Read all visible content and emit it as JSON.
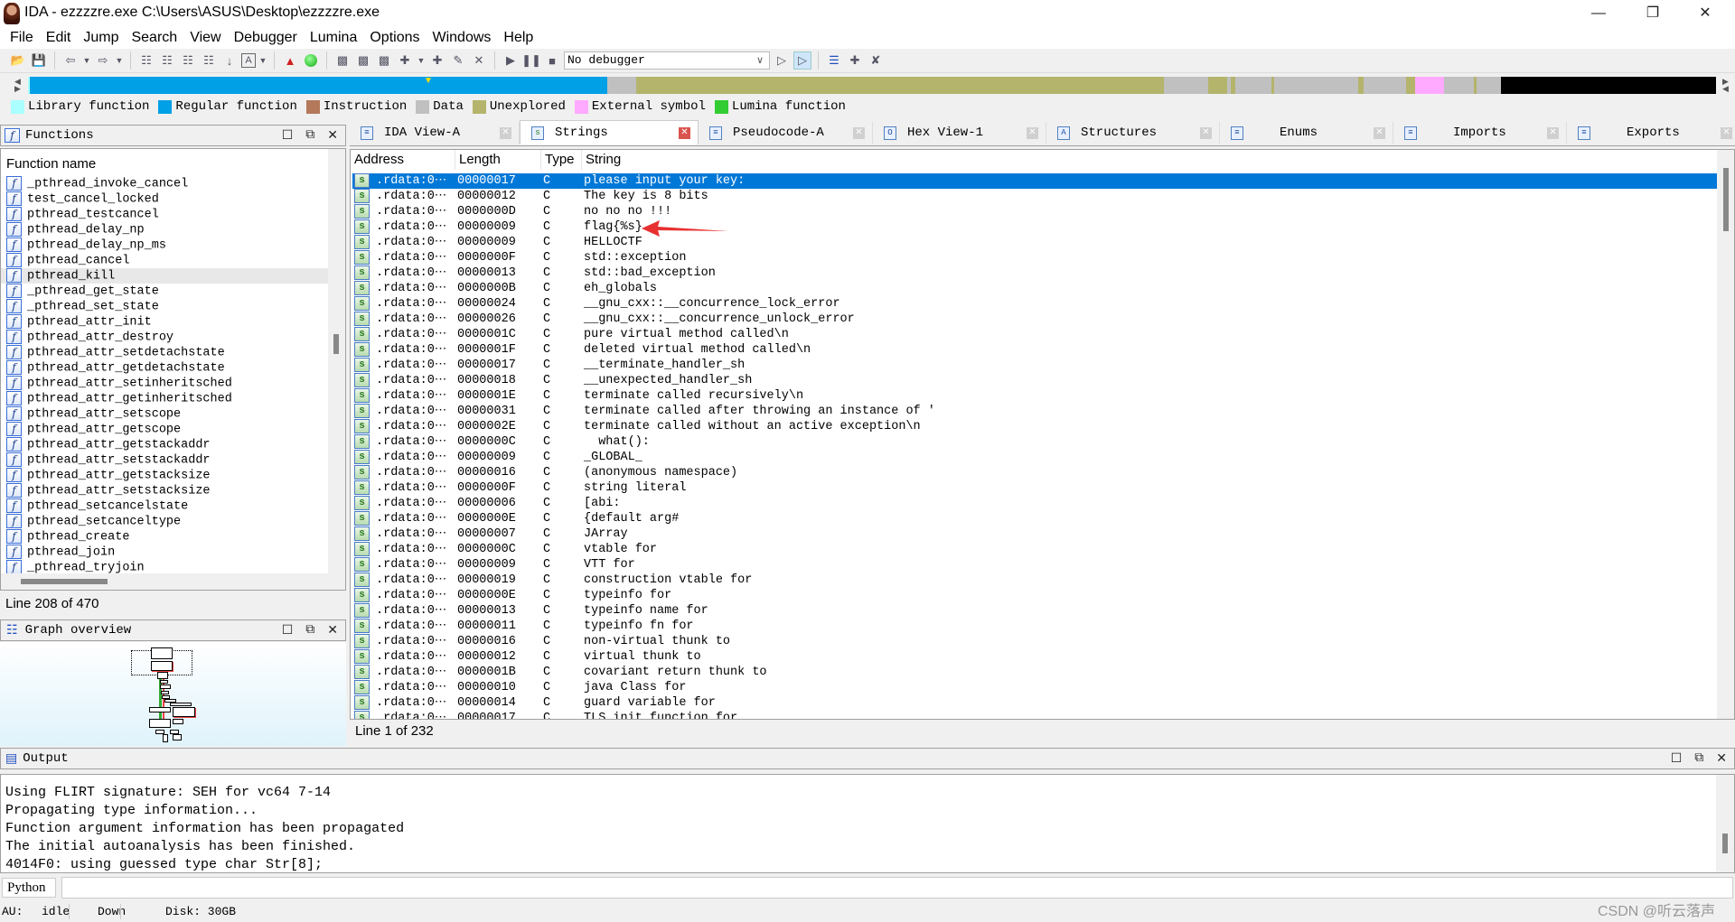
{
  "window": {
    "title": "IDA - ezzzzre.exe C:\\Users\\ASUS\\Desktop\\ezzzzre.exe",
    "controls": [
      "minimize",
      "restore",
      "close"
    ]
  },
  "menu": [
    "File",
    "Edit",
    "Jump",
    "Search",
    "View",
    "Debugger",
    "Lumina",
    "Options",
    "Windows",
    "Help"
  ],
  "toolbar": {
    "debugger_select": "No debugger"
  },
  "legend": [
    {
      "label": "Library function",
      "color": "#aaffff"
    },
    {
      "label": "Regular function",
      "color": "#00a0e6"
    },
    {
      "label": "Instruction",
      "color": "#b4785a"
    },
    {
      "label": "Data",
      "color": "#c0c0c0"
    },
    {
      "label": "Unexplored",
      "color": "#b4b46c"
    },
    {
      "label": "External symbol",
      "color": "#ffaaff"
    },
    {
      "label": "Lumina function",
      "color": "#33cc33"
    }
  ],
  "functions_panel": {
    "title": "Functions",
    "column": "Function name",
    "items": [
      "_pthread_invoke_cancel",
      "test_cancel_locked",
      "pthread_testcancel",
      "pthread_delay_np",
      "pthread_delay_np_ms",
      "pthread_cancel",
      "pthread_kill",
      "_pthread_get_state",
      "_pthread_set_state",
      "pthread_attr_init",
      "pthread_attr_destroy",
      "pthread_attr_setdetachstate",
      "pthread_attr_getdetachstate",
      "pthread_attr_setinheritsched",
      "pthread_attr_getinheritsched",
      "pthread_attr_setscope",
      "pthread_attr_getscope",
      "pthread_attr_getstackaddr",
      "pthread_attr_setstackaddr",
      "pthread_attr_getstacksize",
      "pthread_attr_setstacksize",
      "pthread_setcancelstate",
      "pthread_setcanceltype",
      "pthread_create",
      "pthread_join",
      "_pthread_tryjoin"
    ],
    "highlighted": "pthread_kill",
    "status": "Line 208 of 470"
  },
  "graph_overview": {
    "title": "Graph overview"
  },
  "tabs": [
    {
      "label": "IDA View-A",
      "icon": "disassembly-icon"
    },
    {
      "label": "Strings",
      "icon": "strings-icon",
      "active": true
    },
    {
      "label": "Pseudocode-A",
      "icon": "pseudocode-icon"
    },
    {
      "label": "Hex View-1",
      "icon": "hex-icon"
    },
    {
      "label": "Structures",
      "icon": "structures-icon"
    },
    {
      "label": "Enums",
      "icon": "enums-icon"
    },
    {
      "label": "Imports",
      "icon": "imports-icon"
    },
    {
      "label": "Exports",
      "icon": "exports-icon"
    }
  ],
  "strings": {
    "columns": [
      "Address",
      "Length",
      "Type",
      "String"
    ],
    "rows": [
      [
        ".rdata:0⋯",
        "00000017",
        "C",
        "please input your key:"
      ],
      [
        ".rdata:0⋯",
        "00000012",
        "C",
        "The key is 8 bits"
      ],
      [
        ".rdata:0⋯",
        "0000000D",
        "C",
        "no no no !!!"
      ],
      [
        ".rdata:0⋯",
        "00000009",
        "C",
        "flag{%s}"
      ],
      [
        ".rdata:0⋯",
        "00000009",
        "C",
        "HELLOCTF"
      ],
      [
        ".rdata:0⋯",
        "0000000F",
        "C",
        "std::exception"
      ],
      [
        ".rdata:0⋯",
        "00000013",
        "C",
        "std::bad_exception"
      ],
      [
        ".rdata:0⋯",
        "0000000B",
        "C",
        "eh_globals"
      ],
      [
        ".rdata:0⋯",
        "00000024",
        "C",
        "__gnu_cxx::__concurrence_lock_error"
      ],
      [
        ".rdata:0⋯",
        "00000026",
        "C",
        "__gnu_cxx::__concurrence_unlock_error"
      ],
      [
        ".rdata:0⋯",
        "0000001C",
        "C",
        "pure virtual method called\\n"
      ],
      [
        ".rdata:0⋯",
        "0000001F",
        "C",
        "deleted virtual method called\\n"
      ],
      [
        ".rdata:0⋯",
        "00000017",
        "C",
        "__terminate_handler_sh"
      ],
      [
        ".rdata:0⋯",
        "00000018",
        "C",
        "__unexpected_handler_sh"
      ],
      [
        ".rdata:0⋯",
        "0000001E",
        "C",
        "terminate called recursively\\n"
      ],
      [
        ".rdata:0⋯",
        "00000031",
        "C",
        "terminate called after throwing an instance of '"
      ],
      [
        ".rdata:0⋯",
        "0000002E",
        "C",
        "terminate called without an active exception\\n"
      ],
      [
        ".rdata:0⋯",
        "0000000C",
        "C",
        "  what():"
      ],
      [
        ".rdata:0⋯",
        "00000009",
        "C",
        "_GLOBAL_"
      ],
      [
        ".rdata:0⋯",
        "00000016",
        "C",
        "(anonymous namespace)"
      ],
      [
        ".rdata:0⋯",
        "0000000F",
        "C",
        "string literal"
      ],
      [
        ".rdata:0⋯",
        "00000006",
        "C",
        "[abi:"
      ],
      [
        ".rdata:0⋯",
        "0000000E",
        "C",
        "{default arg#"
      ],
      [
        ".rdata:0⋯",
        "00000007",
        "C",
        "JArray"
      ],
      [
        ".rdata:0⋯",
        "0000000C",
        "C",
        "vtable for"
      ],
      [
        ".rdata:0⋯",
        "00000009",
        "C",
        "VTT for"
      ],
      [
        ".rdata:0⋯",
        "00000019",
        "C",
        "construction vtable for"
      ],
      [
        ".rdata:0⋯",
        "0000000E",
        "C",
        "typeinfo for"
      ],
      [
        ".rdata:0⋯",
        "00000013",
        "C",
        "typeinfo name for"
      ],
      [
        ".rdata:0⋯",
        "00000011",
        "C",
        "typeinfo fn for"
      ],
      [
        ".rdata:0⋯",
        "00000016",
        "C",
        "non-virtual thunk to"
      ],
      [
        ".rdata:0⋯",
        "00000012",
        "C",
        "virtual thunk to"
      ],
      [
        ".rdata:0⋯",
        "0000001B",
        "C",
        "covariant return thunk to"
      ],
      [
        ".rdata:0⋯",
        "00000010",
        "C",
        "java Class for"
      ],
      [
        ".rdata:0⋯",
        "00000014",
        "C",
        "guard variable for"
      ],
      [
        ".rdata:0⋯",
        "00000017",
        "C",
        "TLS init function for"
      ]
    ],
    "selected_index": 0,
    "status": "Line 1 of 232",
    "annotation_color": "#e83030"
  },
  "output": {
    "title": "Output",
    "lines": [
      "Using FLIRT signature: SEH for vc64 7-14",
      "Propagating type information...",
      "Function argument information has been propagated",
      "The initial autoanalysis has been finished.",
      "4014F0: using guessed type char Str[8];"
    ],
    "input_mode": "Python"
  },
  "status_bar": {
    "au": "AU:",
    "state": "idle",
    "direction": "Down",
    "disk": "Disk: 30GB"
  },
  "watermark": "CSDN @听云落声"
}
